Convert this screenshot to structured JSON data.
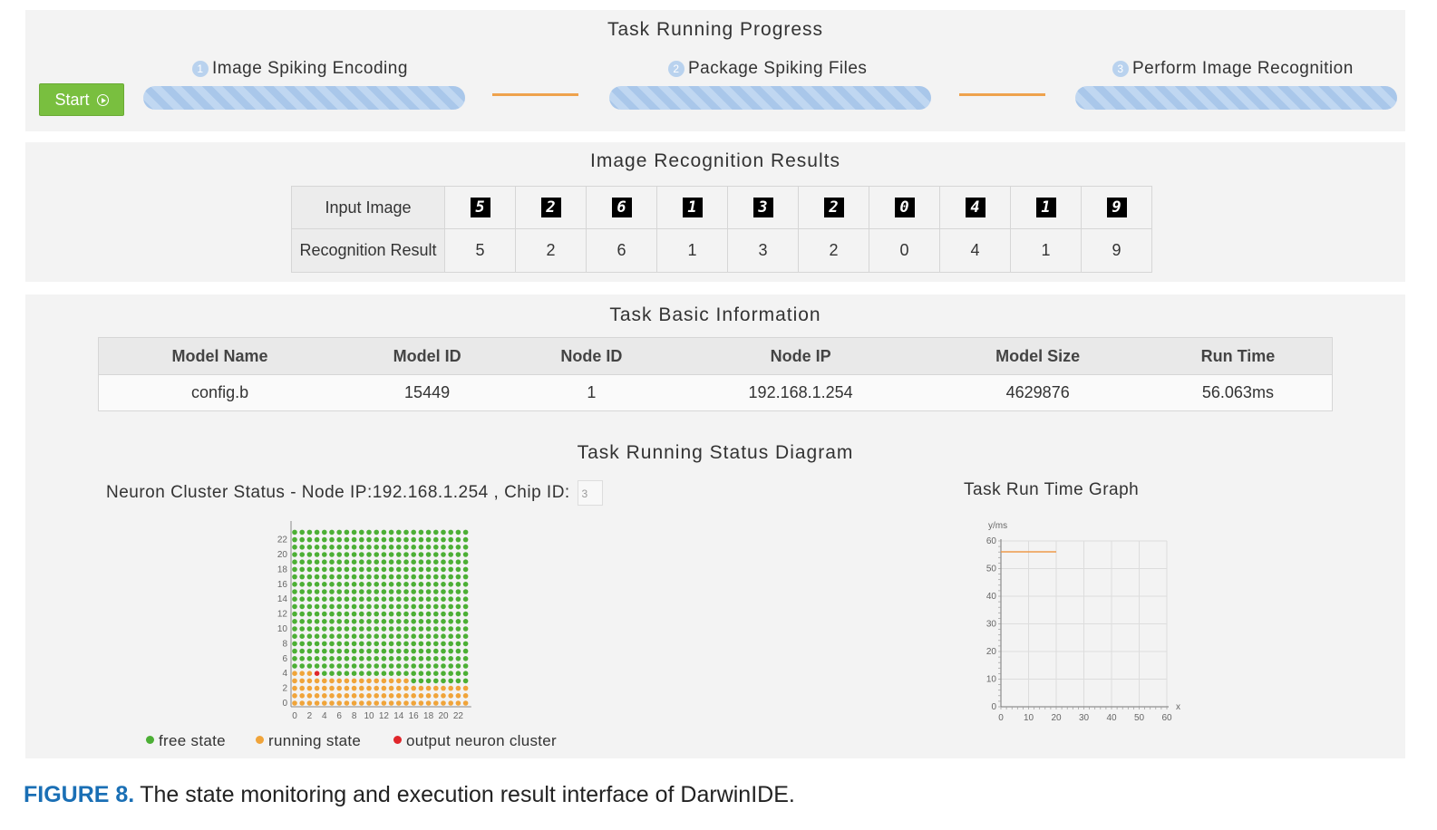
{
  "progress": {
    "title": "Task Running Progress",
    "start_label": "Start",
    "steps": [
      {
        "num": "1",
        "label": "Image Spiking Encoding"
      },
      {
        "num": "2",
        "label": "Package Spiking Files"
      },
      {
        "num": "3",
        "label": "Perform Image Recognition"
      }
    ]
  },
  "recognition": {
    "title": "Image Recognition Results",
    "row_input_label": "Input Image",
    "row_result_label": "Recognition Result",
    "input_digits": [
      "5",
      "2",
      "6",
      "1",
      "3",
      "2",
      "0",
      "4",
      "1",
      "9"
    ],
    "results": [
      "5",
      "2",
      "6",
      "1",
      "3",
      "2",
      "0",
      "4",
      "1",
      "9"
    ]
  },
  "info": {
    "title": "Task Basic Information",
    "headers": [
      "Model Name",
      "Model ID",
      "Node ID",
      "Node IP",
      "Model Size",
      "Run Time"
    ],
    "row": [
      "config.b",
      "15449",
      "1",
      "192.168.1.254",
      "4629876",
      "56.063ms"
    ]
  },
  "status": {
    "title": "Task Running Status Diagram",
    "cluster_title": "Neuron Cluster Status - Node IP:192.168.1.254 , Chip ID:",
    "chip_id": "3",
    "runtime_title": "Task Run Time Graph",
    "legend": [
      {
        "label": "free state",
        "color": "#4caf35"
      },
      {
        "label": "running state",
        "color": "#f0a43a"
      },
      {
        "label": "output neuron cluster",
        "color": "#e0262b"
      }
    ]
  },
  "chart_data": [
    {
      "type": "scatter",
      "title": "",
      "grid_size": [
        24,
        24
      ],
      "x_ticks": [
        "0",
        "2",
        "4",
        "6",
        "8",
        "10",
        "12",
        "14",
        "16",
        "18",
        "20",
        "22"
      ],
      "y_ticks": [
        "0",
        "2",
        "4",
        "6",
        "8",
        "10",
        "12",
        "14",
        "16",
        "18",
        "20",
        "22"
      ],
      "xlim": [
        0,
        23
      ],
      "ylim": [
        0,
        23
      ],
      "running_cells": {
        "full_rows": [
          0,
          1,
          2
        ],
        "partial_row": 3,
        "partial_row_x_range": [
          0,
          15
        ],
        "partial_rows_4": [
          0,
          3
        ]
      },
      "output_cell": [
        3,
        4
      ]
    },
    {
      "type": "line",
      "ylabel": "y/ms",
      "xlabel": "x",
      "xlim": [
        0,
        60
      ],
      "ylim": [
        0,
        60
      ],
      "x_ticks": [
        "0",
        "10",
        "20",
        "30",
        "40",
        "50",
        "60"
      ],
      "y_ticks": [
        "0",
        "10",
        "20",
        "30",
        "40",
        "50",
        "60"
      ],
      "series": [
        {
          "x": [
            0,
            20
          ],
          "y": [
            56.063,
            56.063
          ],
          "color": "#ee9a4a"
        }
      ],
      "grid": true
    }
  ],
  "caption": {
    "fig_label": "FIGURE 8.",
    "text": "The state monitoring and execution result interface of DarwinIDE."
  }
}
